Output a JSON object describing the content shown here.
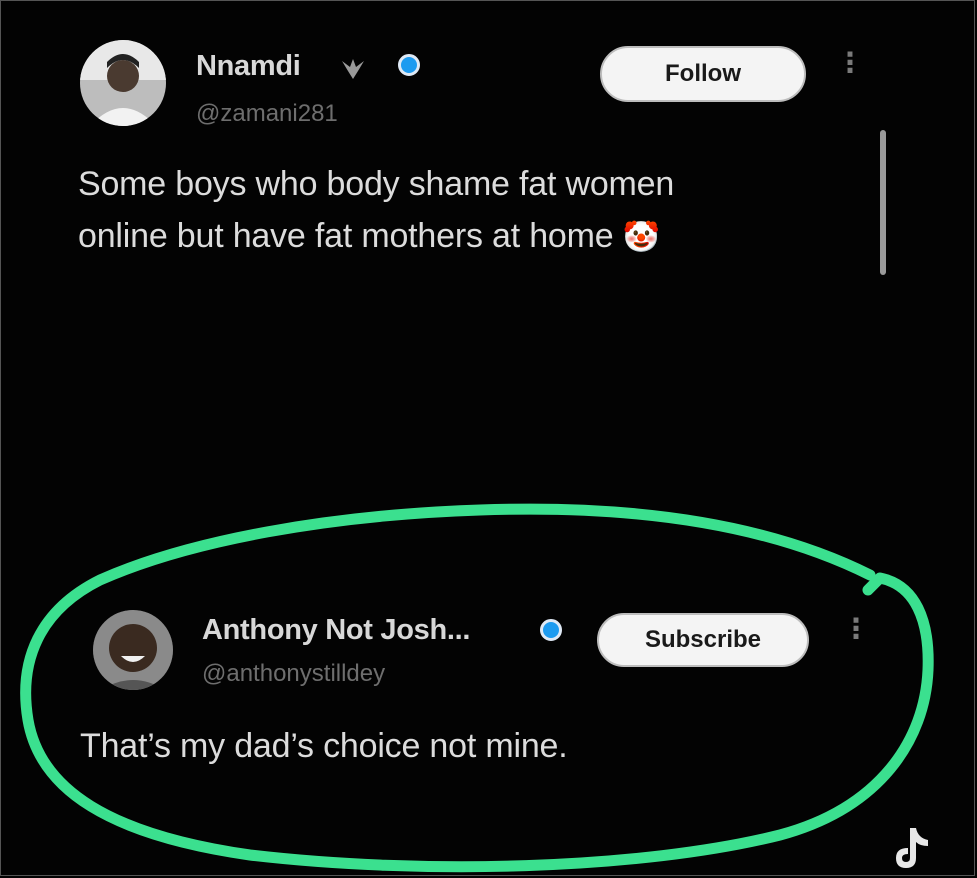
{
  "post": {
    "author_name": "Nnamdi",
    "author_handle": "@zamani281",
    "follow_label": "Follow",
    "text_line1": "Some boys who body shame fat women",
    "text_line2": "online but  have fat mothers at home",
    "emoji": "🤡",
    "badge_icon": "eagle-icon",
    "verified_icon": "verified-badge-icon"
  },
  "reply": {
    "author_name": "Anthony Not Josh...",
    "author_handle": "@anthonystilldey",
    "subscribe_label": "Subscribe",
    "text": "That’s my dad’s choice not mine.",
    "verified_icon": "verified-badge-icon"
  },
  "annotation": {
    "outline_color": "#3be08f"
  },
  "colors": {
    "background": "#030303",
    "verified": "#1d9bf0",
    "text": "#dcdcdc",
    "handle": "#6e6e6e"
  }
}
